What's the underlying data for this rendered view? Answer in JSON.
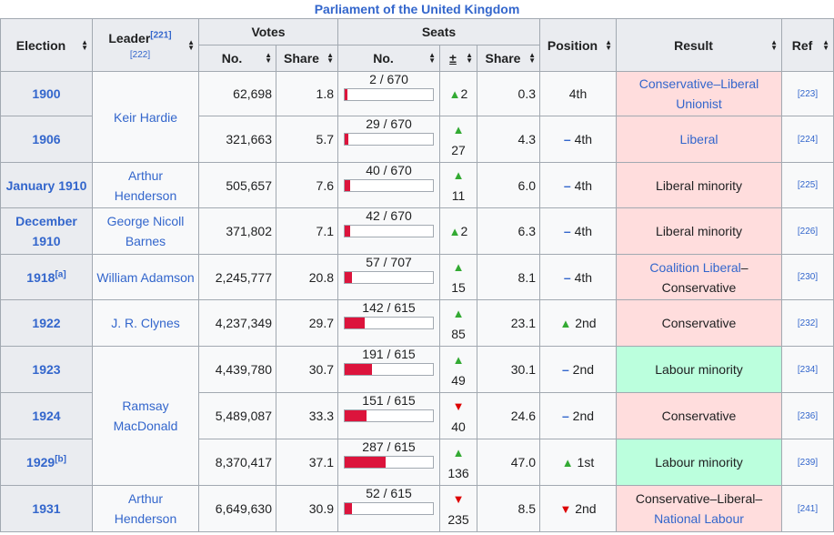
{
  "caption": "Parliament of the United Kingdom",
  "headers": {
    "election": "Election",
    "leader": "Leader",
    "leader_ref1": "[221]",
    "leader_ref2": "[222]",
    "votes": "Votes",
    "seats": "Seats",
    "position": "Position",
    "result": "Result",
    "ref": "Ref",
    "votes_no": "No.",
    "votes_share": "Share",
    "seats_no": "No.",
    "seats_change": "±",
    "seats_share": "Share"
  },
  "icons": {
    "up": "up-triangle-icon",
    "down": "down-triangle-icon",
    "steady": "steady-dash-icon",
    "sort": "sort-arrows-icon"
  },
  "colors": {
    "link": "#3366cc",
    "conservative_bg": "#ffdddd",
    "labour_bg": "#bbffdd",
    "bar_fill": "#dc143c",
    "increase": "#33aa33",
    "decrease": "#dd0000"
  },
  "rows": [
    {
      "election": "1900",
      "election_note": "",
      "votes_no": "62,698",
      "votes_share": "1.8",
      "seats_label": "2 / 670",
      "seats_frac": 0.003,
      "change_dir": "up",
      "change_val": "2",
      "change_inline": true,
      "seats_share": "0.3",
      "position_dir": "",
      "position": "4th",
      "result_parts": [
        "Conservative–Liberal Unionist"
      ],
      "result_type": "cons",
      "result_link": true,
      "ref": "[223]"
    },
    {
      "election": "1906",
      "election_note": "",
      "votes_no": "321,663",
      "votes_share": "5.7",
      "seats_label": "29 / 670",
      "seats_frac": 0.043,
      "change_dir": "up",
      "change_val": "27",
      "change_inline": false,
      "seats_share": "4.3",
      "position_dir": "steady",
      "position": "4th",
      "result_parts": [
        "Liberal"
      ],
      "result_type": "cons",
      "result_link": true,
      "ref": "[224]"
    },
    {
      "election": "January 1910",
      "election_note": "",
      "votes_no": "505,657",
      "votes_share": "7.6",
      "seats_label": "40 / 670",
      "seats_frac": 0.06,
      "change_dir": "up",
      "change_val": "11",
      "change_inline": false,
      "seats_share": "6.0",
      "position_dir": "steady",
      "position": "4th",
      "result_parts": [
        "Liberal minority"
      ],
      "result_type": "cons",
      "result_link": false,
      "ref": "[225]"
    },
    {
      "election": "December 1910",
      "election_note": "",
      "votes_no": "371,802",
      "votes_share": "7.1",
      "seats_label": "42 / 670",
      "seats_frac": 0.063,
      "change_dir": "up",
      "change_val": "2",
      "change_inline": true,
      "seats_share": "6.3",
      "position_dir": "steady",
      "position": "4th",
      "result_parts": [
        "Liberal minority"
      ],
      "result_type": "cons",
      "result_link": false,
      "ref": "[226]"
    },
    {
      "election": "1918",
      "election_note": "[a]",
      "votes_no": "2,245,777",
      "votes_share": "20.8",
      "seats_label": "57 / 707",
      "seats_frac": 0.081,
      "change_dir": "up",
      "change_val": "15",
      "change_inline": false,
      "seats_share": "8.1",
      "position_dir": "steady",
      "position": "4th",
      "result_parts": [
        "Coalition Liberal",
        "–Conservative"
      ],
      "result_type": "cons",
      "result_link": "first",
      "ref": "[230]"
    },
    {
      "election": "1922",
      "election_note": "",
      "votes_no": "4,237,349",
      "votes_share": "29.7",
      "seats_label": "142 / 615",
      "seats_frac": 0.231,
      "change_dir": "up",
      "change_val": "85",
      "change_inline": false,
      "seats_share": "23.1",
      "position_dir": "up",
      "position": "2nd",
      "result_parts": [
        "Conservative"
      ],
      "result_type": "cons",
      "result_link": false,
      "ref": "[232]"
    },
    {
      "election": "1923",
      "election_note": "",
      "votes_no": "4,439,780",
      "votes_share": "30.7",
      "seats_label": "191 / 615",
      "seats_frac": 0.31,
      "change_dir": "up",
      "change_val": "49",
      "change_inline": false,
      "seats_share": "30.1",
      "position_dir": "steady",
      "position": "2nd",
      "result_parts": [
        "Labour minority"
      ],
      "result_type": "lab",
      "result_link": false,
      "ref": "[234]"
    },
    {
      "election": "1924",
      "election_note": "",
      "votes_no": "5,489,087",
      "votes_share": "33.3",
      "seats_label": "151 / 615",
      "seats_frac": 0.246,
      "change_dir": "down",
      "change_val": "40",
      "change_inline": false,
      "seats_share": "24.6",
      "position_dir": "steady",
      "position": "2nd",
      "result_parts": [
        "Conservative"
      ],
      "result_type": "cons",
      "result_link": false,
      "ref": "[236]"
    },
    {
      "election": "1929",
      "election_note": "[b]",
      "votes_no": "8,370,417",
      "votes_share": "37.1",
      "seats_label": "287 / 615",
      "seats_frac": 0.467,
      "change_dir": "up",
      "change_val": "136",
      "change_inline": false,
      "seats_share": "47.0",
      "position_dir": "up",
      "position": "1st",
      "result_parts": [
        "Labour minority"
      ],
      "result_type": "lab",
      "result_link": false,
      "ref": "[239]"
    },
    {
      "election": "1931",
      "election_note": "",
      "votes_no": "6,649,630",
      "votes_share": "30.9",
      "seats_label": "52 / 615",
      "seats_frac": 0.085,
      "change_dir": "down",
      "change_val": "235",
      "change_inline": false,
      "seats_share": "8.5",
      "position_dir": "down",
      "position": "2nd",
      "result_parts": [
        "Conservative–Liberal–",
        "National Labour"
      ],
      "result_type": "cons",
      "result_link": "second",
      "ref": "[241]"
    }
  ],
  "leaders": [
    {
      "name": "Keir Hardie",
      "start": 0,
      "span": 2
    },
    {
      "name": "Arthur Henderson",
      "start": 2,
      "span": 1
    },
    {
      "name": "George Nicoll Barnes",
      "start": 3,
      "span": 1
    },
    {
      "name": "William Adamson",
      "start": 4,
      "span": 1
    },
    {
      "name": "J. R. Clynes",
      "start": 5,
      "span": 1
    },
    {
      "name": "Ramsay MacDonald",
      "start": 6,
      "span": 3
    },
    {
      "name": "Arthur Henderson",
      "start": 9,
      "span": 1
    }
  ]
}
